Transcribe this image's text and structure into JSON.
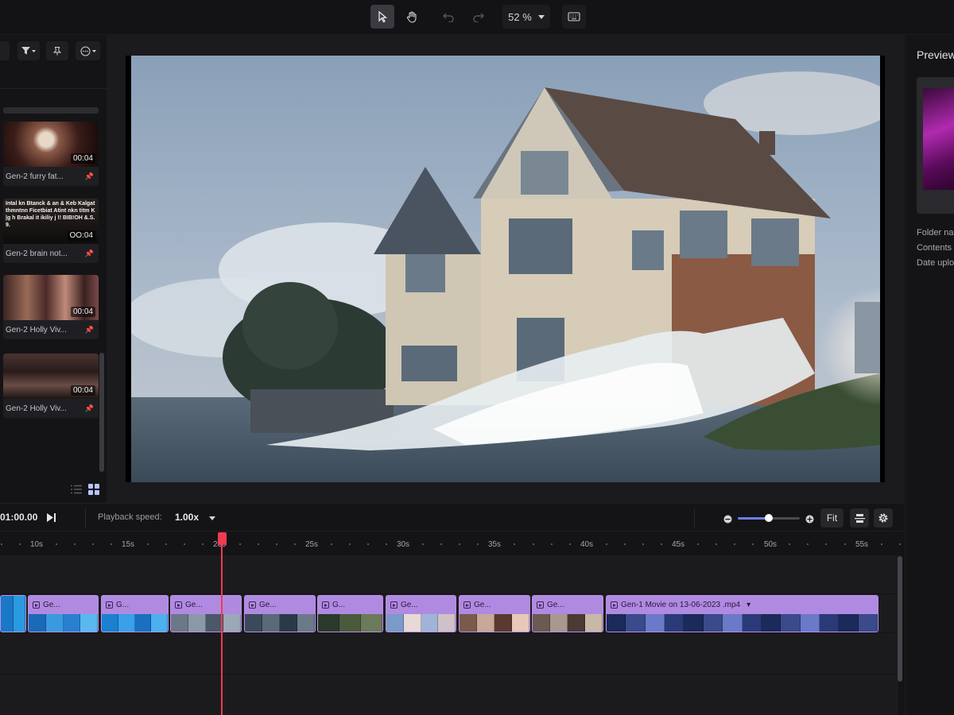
{
  "toolbar": {
    "zoom_value": "52 %",
    "tools": [
      "select-tool",
      "hand-tool",
      "undo",
      "redo",
      "keyboard-shortcuts"
    ]
  },
  "media_panel": {
    "items": [
      {
        "title": "Gen-2 furry fat...",
        "duration": "00:04"
      },
      {
        "title": "Gen-2 brain not...",
        "duration": "00:04",
        "thumb_text": "Intal kn Btanck & an & Keb Kalgat thmntnn Ficetbiat Atint nkn titm K|g h Brakal it ikiliy j !! BIB!OH &.S.9.",
        "overlay_text": "OO:04"
      },
      {
        "title": "Gen-2 Holly Viv...",
        "duration": "00:04"
      },
      {
        "title": "Gen-2 Holly Viv...",
        "duration": "00:04"
      }
    ]
  },
  "right_panel": {
    "title": "Preview",
    "meta": [
      "Folder na",
      "Contents",
      "Date uplo"
    ]
  },
  "playback": {
    "time": "01:00.00",
    "speed_label": "Playback speed:",
    "speed_value": "1.00x",
    "zoom_level": 0.5,
    "fit_label": "Fit"
  },
  "timeline": {
    "ticks": [
      "10s",
      "15s",
      "20s",
      "25s",
      "30s",
      "35s",
      "40s",
      "45s",
      "50s",
      "55s"
    ],
    "clips": [
      {
        "label": ""
      },
      {
        "label": "Ge..."
      },
      {
        "label": "G..."
      },
      {
        "label": "Ge..."
      },
      {
        "label": "Ge..."
      },
      {
        "label": "G..."
      },
      {
        "label": "Ge..."
      },
      {
        "label": "Ge..."
      },
      {
        "label": "Ge..."
      },
      {
        "label": "Gen-1 Movie on 13-06-2023 .mp4"
      }
    ]
  },
  "colors": {
    "accent": "#6d7cf2",
    "clip": "#a77bdd",
    "playhead": "#ef3b52"
  }
}
